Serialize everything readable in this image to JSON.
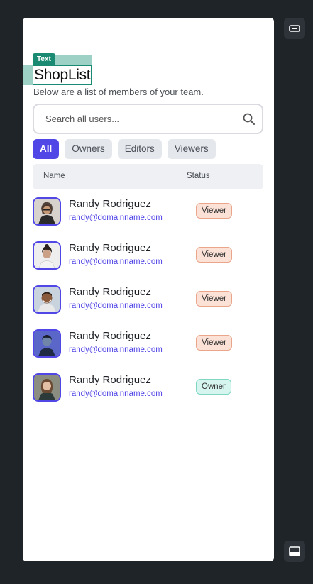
{
  "editor": {
    "text_tag": "Text"
  },
  "header": {
    "title": "ShopList",
    "subtitle": "Below are a list of members of your team."
  },
  "search": {
    "placeholder": "Search all users..."
  },
  "tabs": [
    {
      "label": "All",
      "active": true
    },
    {
      "label": "Owners"
    },
    {
      "label": "Editors"
    },
    {
      "label": "Viewers"
    }
  ],
  "table": {
    "headers": {
      "name": "Name",
      "status": "Status"
    },
    "rows": [
      {
        "name": "Randy Rodriguez",
        "email": "randy@domainname.com",
        "status": "Viewer"
      },
      {
        "name": "Randy Rodriguez",
        "email": "randy@domainname.com",
        "status": "Viewer"
      },
      {
        "name": "Randy Rodriguez",
        "email": "randy@domainname.com",
        "status": "Viewer"
      },
      {
        "name": "Randy Rodriguez",
        "email": "randy@domainname.com",
        "status": "Viewer"
      },
      {
        "name": "Randy Rodriguez",
        "email": "randy@domainname.com",
        "status": "Owner"
      }
    ]
  },
  "colors": {
    "accent": "#5146e6",
    "background": "#1f2428",
    "viewer_badge": "#fbe1d6",
    "owner_badge": "#d6f5ef",
    "selection": "#1b8a72"
  },
  "icons": {
    "top_side": "toggle-icon",
    "bottom_side": "panel-icon",
    "search": "search-icon"
  }
}
